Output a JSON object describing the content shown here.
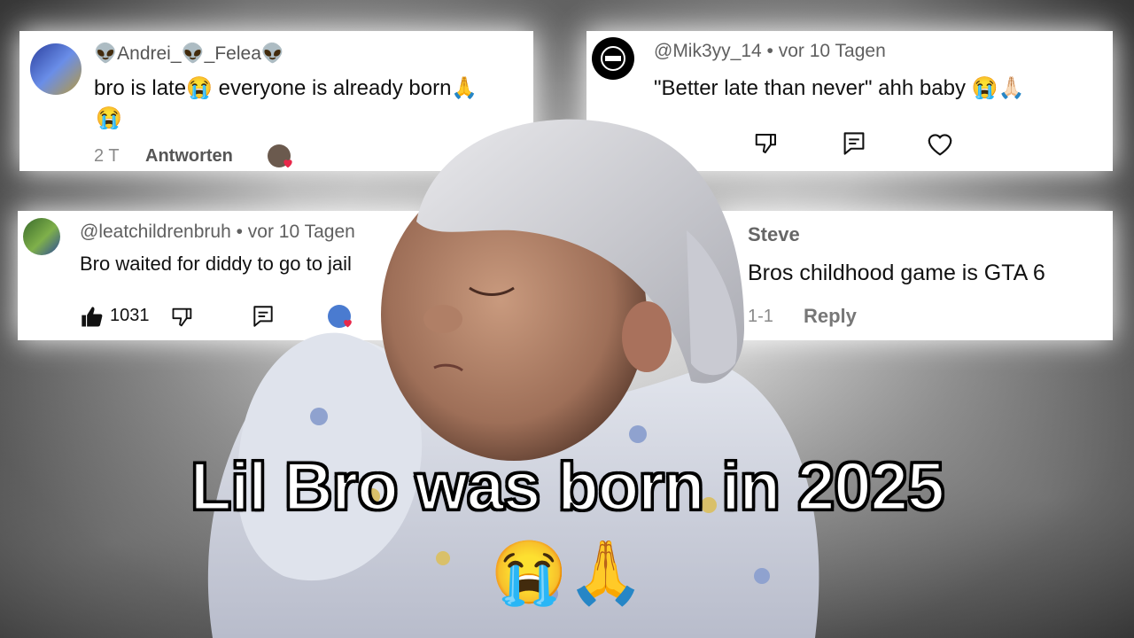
{
  "comments": [
    {
      "author": "👽Andrei_👽_Felea👽",
      "text_line1": "bro is late😭 everyone is already born🙏",
      "text_line2": "😭",
      "time": "2 T",
      "reply_label": "Antworten"
    },
    {
      "author": "@Mik3yy_14 • vor 10 Tagen",
      "text_line1": "\"Better late than never\" ahh baby 😭🙏🏻"
    },
    {
      "author": "@leatchildrenbruh • vor 10 Tagen",
      "text_line1": "Bro waited for diddy to go to jail",
      "likes": "1031"
    },
    {
      "author": "Steve",
      "text_line1": "Bros childhood game is GTA 6",
      "time": "1-1",
      "reply_label": "Reply"
    }
  ],
  "caption": {
    "title": "Lil Bro was born in 2025",
    "emojis": "😭🙏"
  },
  "icons": {
    "thumbs_up": "thumbs-up-icon",
    "thumbs_down": "thumbs-down-icon",
    "reply": "comment-reply-icon",
    "heart": "heart-icon"
  }
}
